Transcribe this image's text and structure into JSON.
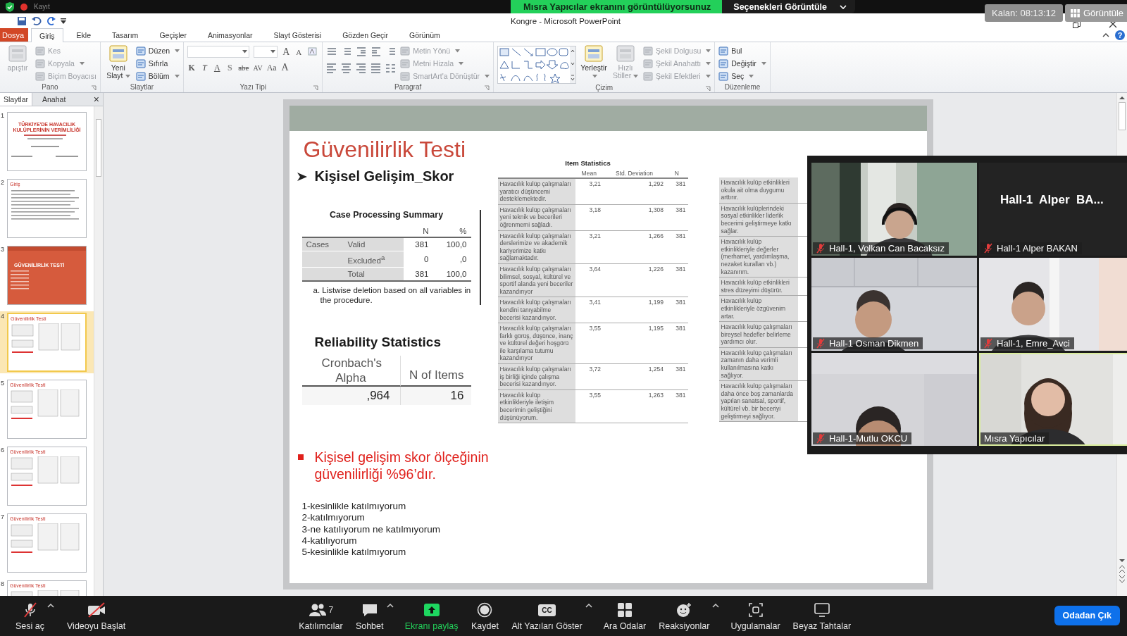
{
  "zoom": {
    "recording_label": "Kayıt",
    "sharing_notice": "Mısra Yapıcılar ekranını görüntülüyorsunuz",
    "options_button": "Seçenekleri Görüntüle",
    "timer": "Kalan: 08:13:12",
    "view_button": "Görüntüle"
  },
  "window": {
    "title": "Kongre - Microsoft PowerPoint",
    "help": "?"
  },
  "ribbon": {
    "file_tab": "Dosya",
    "tabs": [
      {
        "label": "Giriş",
        "selected": true
      },
      {
        "label": "Ekle",
        "selected": false
      },
      {
        "label": "Tasarım",
        "selected": false
      },
      {
        "label": "Geçişler",
        "selected": false
      },
      {
        "label": "Animasyonlar",
        "selected": false
      },
      {
        "label": "Slayt Gösterisi",
        "selected": false
      },
      {
        "label": "Gözden Geçir",
        "selected": false
      },
      {
        "label": "Görünüm",
        "selected": false
      }
    ],
    "groups": [
      {
        "label": "Pano",
        "launcher": true,
        "items": [
          {
            "kind": "large",
            "label": "apıştır",
            "disabled": true,
            "dropdown": false
          },
          {
            "kind": "small",
            "label": "Kes",
            "disabled": true,
            "dropdown": false
          },
          {
            "kind": "small",
            "label": "Kopyala",
            "disabled": true,
            "dropdown": true
          },
          {
            "kind": "small",
            "label": "Biçim Boyacısı",
            "disabled": true,
            "dropdown": false
          }
        ]
      },
      {
        "label": "Slaytlar",
        "launcher": false,
        "items": [
          {
            "kind": "large",
            "label": "Yeni Slayt",
            "disabled": false,
            "dropdown": true
          },
          {
            "kind": "small",
            "label": "Düzen",
            "disabled": false,
            "dropdown": true
          },
          {
            "kind": "small",
            "label": "Sıfırla",
            "disabled": false,
            "dropdown": false
          },
          {
            "kind": "small",
            "label": "Bölüm",
            "disabled": false,
            "dropdown": true
          }
        ]
      },
      {
        "label": "Yazı Tipi",
        "launcher": true,
        "items": [
          {
            "kind": "font-tools",
            "size_glyphs": [
              "A",
              "A"
            ],
            "format_glyphs": [
              "K",
              "T",
              "A",
              "S",
              "abe",
              "AV",
              "Aa",
              "A"
            ]
          }
        ]
      },
      {
        "label": "Paragraf",
        "launcher": true,
        "items": [
          {
            "kind": "paragraph-tools"
          },
          {
            "kind": "small",
            "label": "Metin Yönü",
            "disabled": true,
            "dropdown": true
          },
          {
            "kind": "small",
            "label": "Metni Hizala",
            "disabled": true,
            "dropdown": true
          },
          {
            "kind": "small",
            "label": "SmartArt'a Dönüştür",
            "disabled": true,
            "dropdown": true
          }
        ]
      },
      {
        "label": "Çizim",
        "launcher": true,
        "items": [
          {
            "kind": "shape-gallery"
          },
          {
            "kind": "large",
            "label": "Yerleştir",
            "disabled": false,
            "dropdown": true
          },
          {
            "kind": "large",
            "label": "Hızlı Stiller",
            "disabled": true,
            "dropdown": true
          },
          {
            "kind": "small",
            "label": "Şekil Dolgusu",
            "disabled": true,
            "dropdown": true
          },
          {
            "kind": "small",
            "label": "Şekil Anahattı",
            "disabled": true,
            "dropdown": true
          },
          {
            "kind": "small",
            "label": "Şekil Efektleri",
            "disabled": true,
            "dropdown": true
          }
        ]
      },
      {
        "label": "Düzenleme",
        "launcher": false,
        "items": [
          {
            "kind": "small",
            "label": "Bul",
            "disabled": false,
            "dropdown": false
          },
          {
            "kind": "small",
            "label": "Değiştir",
            "disabled": false,
            "dropdown": true
          },
          {
            "kind": "small",
            "label": "Seç",
            "disabled": false,
            "dropdown": true
          }
        ]
      }
    ]
  },
  "slides_panel": {
    "tabs": [
      {
        "label": "Slaytlar",
        "selected": true
      },
      {
        "label": "Anahat",
        "selected": false
      }
    ],
    "close": "×",
    "slides": [
      {
        "number": "1",
        "kind": "title",
        "title": "TÜRKİYE'DE HAVACILIK KULÜPLERİNİN VERİMLİLİĞİ",
        "selected": false
      },
      {
        "number": "2",
        "kind": "text",
        "title": "Giriş",
        "selected": false
      },
      {
        "number": "3",
        "kind": "section",
        "title": "GÜVENİLİRLİK TESTİ",
        "selected": false
      },
      {
        "number": "4",
        "kind": "tables",
        "title": "Güvenilirlik Testi",
        "selected": true
      },
      {
        "number": "5",
        "kind": "tables",
        "title": "Güvenilirlik Testi",
        "selected": false
      },
      {
        "number": "6",
        "kind": "tables",
        "title": "Güvenilirlik Testi",
        "selected": false
      },
      {
        "number": "7",
        "kind": "tables",
        "title": "Güvenilirlik Testi",
        "selected": false
      },
      {
        "number": "8",
        "kind": "tables",
        "title": "Güvenilirlik Testi",
        "selected": false
      }
    ]
  },
  "slide": {
    "title": "Güvenilirlik Testi",
    "bullet": "Kişisel Gelişim_Skor",
    "case_summary": {
      "title": "Case Processing Summary",
      "columns": [
        "N",
        "%"
      ],
      "group": "Cases",
      "rows": [
        {
          "label": "Valid",
          "n": "381",
          "pct": "100,0"
        },
        {
          "label": "Excluded$^{a}$",
          "n": "0",
          "pct": ",0"
        },
        {
          "label": "Total",
          "n": "381",
          "pct": "100,0"
        }
      ],
      "footnote": "a. Listwise deletion based on all variables in the procedure."
    },
    "reliability": {
      "title": "Reliability Statistics",
      "columns": [
        "Cronbach's Alpha",
        "N of Items"
      ],
      "values": [
        ",964",
        "16"
      ]
    },
    "item_statistics": {
      "title": "Item Statistics",
      "columns": [
        "Mean",
        "Std. Deviation",
        "N"
      ],
      "rows": [
        {
          "label": "Havacılık kulüp çalışmaları yaratıcı düşüncemi desteklemektedir.",
          "mean": "3,21",
          "sd": "1,292",
          "n": "381"
        },
        {
          "label": "Havacılık kulüp çalışmaları yeni teknik ve becerileri öğrenmemi sağladı.",
          "mean": "3,18",
          "sd": "1,308",
          "n": "381"
        },
        {
          "label": "Havacılık kulüp çalışmaları derslerimize ve akademik kariyerimize katkı sağlamaktadır.",
          "mean": "3,21",
          "sd": "1,266",
          "n": "381"
        },
        {
          "label": "Havacılık kulüp çalışmaları bilimsel, sosyal, kültürel ve sportif alanda yeni beceriler kazandırıyor",
          "mean": "3,64",
          "sd": "1,226",
          "n": "381"
        },
        {
          "label": "Havacılık kulüp çalışmaları kendini tanıyabilme becerisi kazandırıyor.",
          "mean": "3,41",
          "sd": "1,199",
          "n": "381"
        },
        {
          "label": "Havacılık kulüp çalışmaları farklı görüş, düşünce, inanç ve kültürel değeri hoşgörü ile karşılama tutumu kazandırıyor",
          "mean": "3,55",
          "sd": "1,195",
          "n": "381"
        },
        {
          "label": "Havacılık kulüp çalışmaları iş birliği içinde çalışma becerisi kazandırıyor.",
          "mean": "3,72",
          "sd": "1,254",
          "n": "381"
        },
        {
          "label": "Havacılık kulüp etkinlikleriyle iletişim becerimin geliştiğini düşünüyorum.",
          "mean": "3,55",
          "sd": "1,263",
          "n": "381"
        }
      ]
    },
    "side_table": {
      "rows": [
        "Havacılık kulüp etkinlikleri okula ait olma duygumu arttırır.",
        "Havacılık kulüplerindeki sosyal etkinlikler liderlik becerimi geliştirmeye katkı sağlar.",
        "Havacılık kulüp etkinlikleriyle değerler (merhamet, yardımlaşma, nezaket kuralları vb.) kazanırım.",
        "Havacılık kulüp etkinlikleri stres düzeyimi düşürür.",
        "Havacılık kulüp etkinlikleriyle özgüvenim artar.",
        "Havacılık kulüp çalışmaları bireysel hedefler belirleme yardımcı olur.",
        "Havacılık kulüp çalışmaları zamanın daha verimli kullanılmasına katkı sağlıyor.",
        "Havacılık kulüp çalışmaları daha önce boş zamanlarda yapılan sanatsal, sportif, kültürel vb. bir beceriyi geliştirmeyi sağlıyor."
      ]
    },
    "conclusion": "Kişisel gelişim skor ölçeğinin güvenilirliği %96’dır.",
    "scale": [
      "1-kesinlikle katılmıyorum",
      "2-katılmıyorum",
      "3-ne katılıyorum ne katılmıyorum",
      "4-katılıyorum",
      "5-kesinlikle katılmıyorum"
    ]
  },
  "video_panel": {
    "tiles": [
      {
        "name": "Hall-1, Volkan Can Bacaksız",
        "muted": true,
        "video": true,
        "speaking": false
      },
      {
        "name": "Hall-1 Alper BAKAN",
        "display_name": "Hall-1  Alper  BA...",
        "muted": true,
        "video": false,
        "speaking": false
      },
      {
        "name": "Hall-1 Osman Dikmen",
        "muted": true,
        "video": true,
        "speaking": false
      },
      {
        "name": "Hall-1, Emre_Avci",
        "muted": true,
        "video": true,
        "speaking": false
      },
      {
        "name": "Hall-1-Mutlu OKCU",
        "muted": true,
        "video": true,
        "speaking": false
      },
      {
        "name": "Mısra Yapıcılar",
        "muted": false,
        "video": true,
        "speaking": true
      }
    ]
  },
  "meeting_toolbar": {
    "left_items": [
      {
        "kind": "mic",
        "label": "Sesi aç",
        "caret": true,
        "muted": true
      },
      {
        "kind": "video",
        "label": "Videoyu Başlat",
        "caret": false,
        "muted": true
      }
    ],
    "center_items": [
      {
        "kind": "participants",
        "label": "Katılımcılar",
        "count": "7",
        "caret": false
      },
      {
        "kind": "chat",
        "label": "Sohbet",
        "caret": true
      },
      {
        "kind": "share",
        "label": "Ekranı paylaş",
        "caret": false,
        "active": true
      },
      {
        "kind": "record",
        "label": "Kaydet",
        "caret": false
      },
      {
        "kind": "captions",
        "label": "Alt Yazıları Göster",
        "caret": true,
        "badge": "CC"
      },
      {
        "kind": "rooms",
        "label": "Ara Odalar",
        "caret": false
      },
      {
        "kind": "reactions",
        "label": "Reaksiyonlar",
        "caret": true
      },
      {
        "kind": "apps",
        "label": "Uygulamalar",
        "caret": false
      },
      {
        "kind": "whiteboard",
        "label": "Beyaz Tahtalar",
        "caret": false
      }
    ],
    "leave_button": "Odadan Çık"
  }
}
